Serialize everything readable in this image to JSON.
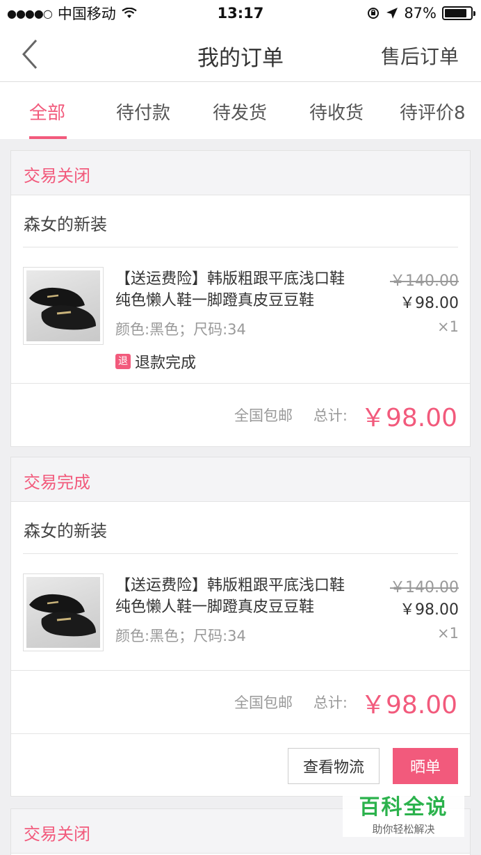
{
  "status_bar": {
    "signal": "●●●●○",
    "carrier": "中国移动",
    "wifi": "wifi-icon",
    "time": "13:17",
    "battery": "87%"
  },
  "nav": {
    "title": "我的订单",
    "right_label": "售后订单",
    "back_icon": "chevron-left-icon"
  },
  "tabs": [
    {
      "label": "全部",
      "active": true
    },
    {
      "label": "待付款"
    },
    {
      "label": "待发货"
    },
    {
      "label": "待收货"
    },
    {
      "label": "待评价8"
    }
  ],
  "accent_color": "#f25a7c",
  "orders": [
    {
      "status": "交易关闭",
      "shop": "森女的新装",
      "item": {
        "title": "【送运费险】韩版粗跟平底浅口鞋纯色懒人鞋一脚蹬真皮豆豆鞋",
        "spec": "颜色:黑色；尺码:34",
        "price_original": "￥140.00",
        "price_now": "￥98.00",
        "quantity": "×1",
        "refund_badge": "退",
        "refund_text": "退款完成"
      },
      "shipping": "全国包邮",
      "total_label": "总计:",
      "total": "￥98.00"
    },
    {
      "status": "交易完成",
      "shop": "森女的新装",
      "item": {
        "title": "【送运费险】韩版粗跟平底浅口鞋纯色懒人鞋一脚蹬真皮豆豆鞋",
        "spec": "颜色:黑色；尺码:34",
        "price_original": "￥140.00",
        "price_now": "￥98.00",
        "quantity": "×1"
      },
      "shipping": "全国包邮",
      "total_label": "总计:",
      "total": "￥98.00",
      "actions": [
        "查看物流",
        "晒单"
      ]
    },
    {
      "status": "交易关闭"
    }
  ],
  "watermark": {
    "title": "百科全说",
    "subtitle": "助你轻松解决"
  }
}
